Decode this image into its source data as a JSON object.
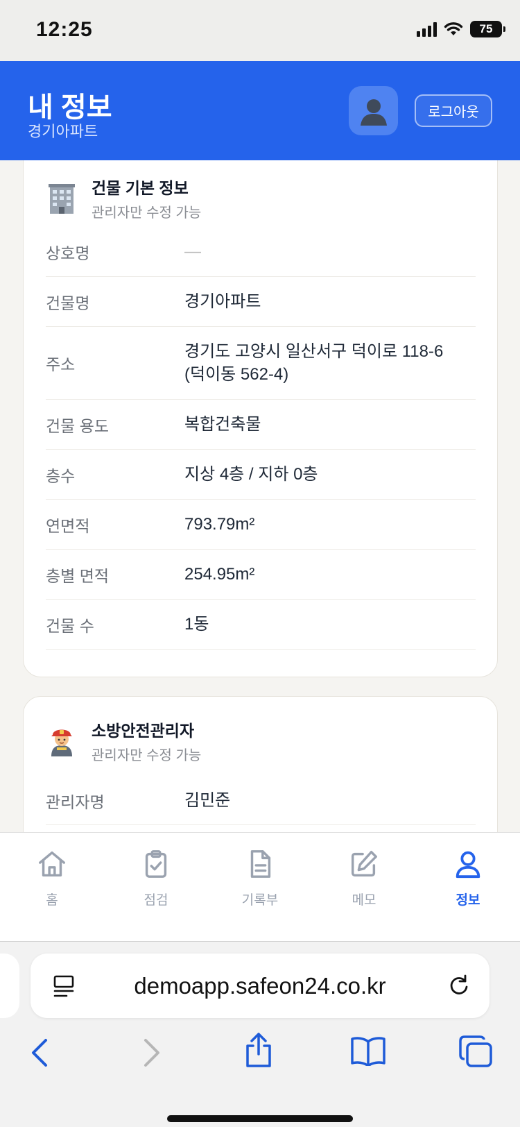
{
  "status": {
    "time": "12:25",
    "battery": "75"
  },
  "header": {
    "title": "내 정보",
    "subtitle": "경기아파트",
    "logout_label": "로그아웃"
  },
  "building_card": {
    "icon": "office-building-emoji",
    "title": "건물 기본 정보",
    "subtitle": "관리자만 수정 가능",
    "rows": [
      {
        "label": "상호명",
        "value": "—"
      },
      {
        "label": "건물명",
        "value": "경기아파트"
      },
      {
        "label": "주소",
        "value": "경기도 고양시 일산서구 덕이로 118-6",
        "value2": "(덕이동 562-4)"
      },
      {
        "label": "건물 용도",
        "value": "복합건축물"
      },
      {
        "label": "층수",
        "value": "지상 4층 / 지하 0층"
      },
      {
        "label": "연면적",
        "value": "793.79m²"
      },
      {
        "label": "층별 면적",
        "value": "254.95m²"
      },
      {
        "label": "건물 수",
        "value": "1동"
      }
    ]
  },
  "fire_card": {
    "icon": "firefighter-emoji",
    "title": "소방안전관리자",
    "subtitle": "관리자만 수정 가능",
    "rows": [
      {
        "label": "관리자명",
        "value": "김민준"
      }
    ]
  },
  "tabs": [
    {
      "label": "홈",
      "icon": "home-icon",
      "active": false
    },
    {
      "label": "점검",
      "icon": "clipboard-check-icon",
      "active": false
    },
    {
      "label": "기록부",
      "icon": "document-icon",
      "active": false
    },
    {
      "label": "메모",
      "icon": "edit-icon",
      "active": false
    },
    {
      "label": "정보",
      "icon": "user-icon",
      "active": true
    }
  ],
  "browser": {
    "url": "demoapp.safeon24.co.kr"
  },
  "colors": {
    "primary": "#2563eb",
    "tab_inactive": "#9aa2af"
  }
}
